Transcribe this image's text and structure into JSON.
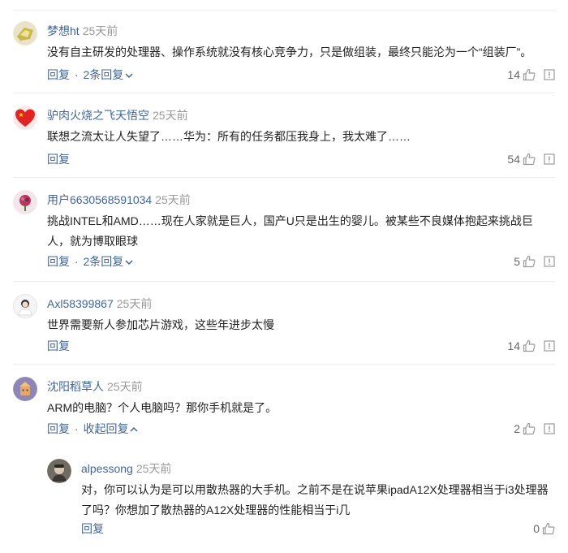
{
  "comments": [
    {
      "user": "梦想ht",
      "time": "25天前",
      "text": "没有自主研发的处理器、操作系统就没有核心竞争力，只是做组装，最终只能沦为一个“组装厂”。",
      "reply": "回复",
      "sep": "·",
      "more": "2条回复",
      "likes": "14"
    },
    {
      "user": "驴肉火烧之飞天悟空",
      "time": "25天前",
      "text": "联想之流太让人失望了……华为：所有的任务都压我身上，我太难了……",
      "reply": "回复",
      "likes": "54"
    },
    {
      "user": "用户6630568591034",
      "time": "25天前",
      "text": "挑战INTEL和AMD……现在人家就是巨人，国产U只是出生的婴儿。被某些不良媒体抱起来挑战巨人，就为博取眼球",
      "reply": "回复",
      "sep": "·",
      "more": "2条回复",
      "likes": "5"
    },
    {
      "user": "Axl58399867",
      "time": "25天前",
      "text": "世界需要新人参加芯片游戏，这些年进步太慢",
      "reply": "回复",
      "likes": "14"
    },
    {
      "user": "沈阳稻草人",
      "time": "25天前",
      "text": "ARM的电脑？个人电脑吗？那你手机就是了。",
      "reply": "回复",
      "sep": "·",
      "more": "收起回复",
      "likes": "2"
    }
  ],
  "child_reply": {
    "user": "alpessong",
    "time": "25天前",
    "text": "对，你可以认为是可以用散热器的大手机。之前不是在说苹果ipadA12X处理器相当于i3处理器了吗？你想加了散热器的A12X处理器的性能相当于i几",
    "reply": "回复",
    "likes": "0"
  },
  "colors": {
    "username": "#406599",
    "time": "#999999",
    "text": "#222222",
    "divider": "#ececec"
  },
  "icons": {
    "like": "thumbs-up-icon",
    "report": "report-icon",
    "expand": "chevron-down-icon",
    "collapse": "chevron-up-icon"
  }
}
